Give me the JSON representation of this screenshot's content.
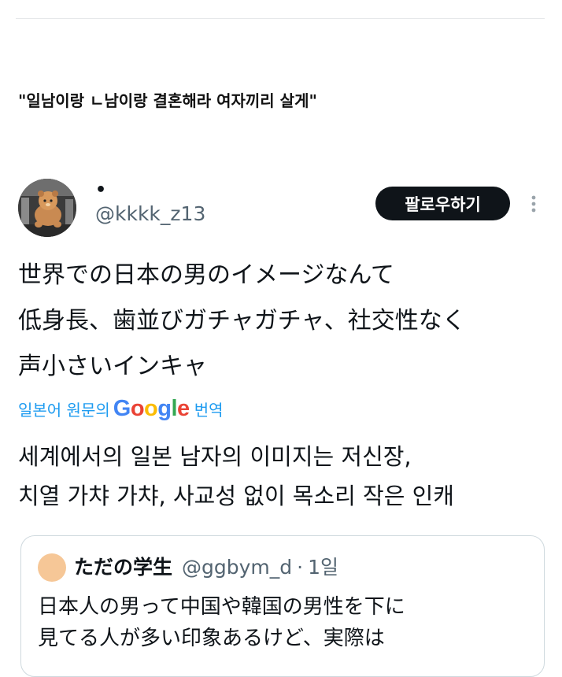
{
  "post": {
    "title": "\"일남이랑 ㄴ남이랑 결혼해라 여자끼리 살게\""
  },
  "tweet": {
    "display_name": "•",
    "handle": "@kkkk_z13",
    "follow_label": "팔로우하기",
    "more_icon": "more-vertical-icon",
    "text_lines": [
      "世界での日本の男のイメージなんて",
      "低身長、歯並びガチャガチャ、社交性なく",
      "声小さいインキャ"
    ],
    "translation": {
      "prefix": "일본어 원문의",
      "provider": "Google",
      "suffix": "번역",
      "lines": [
        "세계에서의 일본 남자의 이미지는 저신장,",
        "치열 가챠 가챠, 사교성 없이 목소리 작은 인캐"
      ]
    },
    "quote": {
      "name": "ただの学生",
      "handle": "@ggbym_d",
      "separator": "·",
      "time": "1일",
      "lines": [
        "日本人の男って中国や韓国の男性を下に",
        "見てる人が多い印象あるけど、実際は"
      ]
    }
  },
  "colors": {
    "link_blue": "#1d9bf0",
    "text_primary": "#0f1419",
    "text_secondary": "#536471",
    "follow_bg": "#0f1419",
    "border": "#cfd9de",
    "google_blue": "#4285F4",
    "google_red": "#EA4335",
    "google_yellow": "#FBBC05",
    "google_green": "#34A853"
  }
}
